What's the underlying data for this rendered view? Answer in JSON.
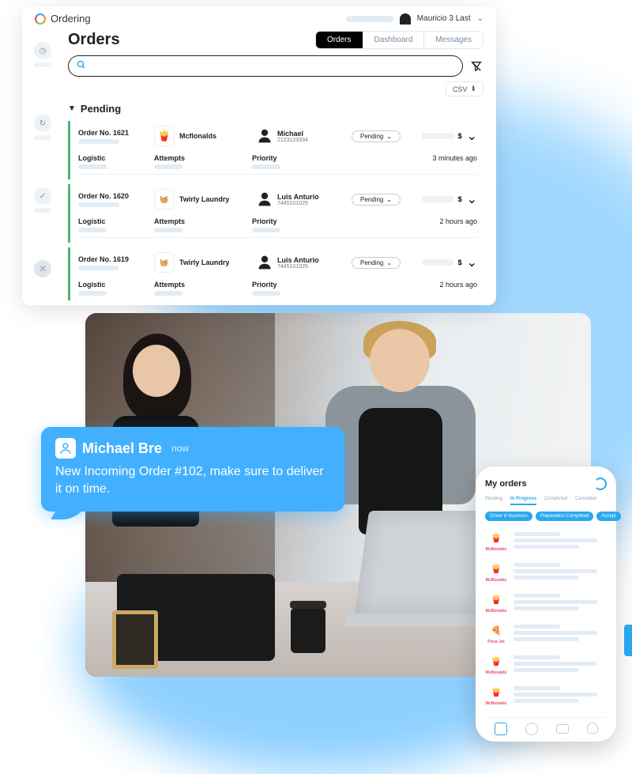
{
  "brand": "Ordering",
  "user": {
    "name": "Mauricio 3 Last"
  },
  "header": {
    "title": "Orders"
  },
  "tabs": [
    "Orders",
    "Dashboard",
    "Messages"
  ],
  "activeTab": 0,
  "csv_label": "CSV",
  "section": "Pending",
  "meta_labels": {
    "logistic": "Logistic",
    "attempts": "Attempts",
    "priority": "Priority"
  },
  "currency": "$",
  "orders": [
    {
      "num": "Order No. 1621",
      "business": "Mcflonalds",
      "business_kind": "fries",
      "customer": {
        "name": "Michael",
        "phone": "2123123334"
      },
      "status": "Pending",
      "time": "3 minutes ago"
    },
    {
      "num": "Order No. 1620",
      "business": "Twirly Laundry",
      "business_kind": "laundry",
      "customer": {
        "name": "Luis Anturio",
        "phone": "7445101025"
      },
      "status": "Pending",
      "time": "2 hours ago"
    },
    {
      "num": "Order No. 1619",
      "business": "Twirly Laundry",
      "business_kind": "laundry",
      "customer": {
        "name": "Luis Anturio",
        "phone": "7445101025"
      },
      "status": "Pending",
      "time": "2 hours ago"
    }
  ],
  "chat": {
    "name": "Michael Bre",
    "time": "now",
    "message": "New Incoming Order #102, make sure to deliver it on time."
  },
  "phone": {
    "title": "My orders",
    "tabs": [
      "Pending",
      "In Progress",
      "Completed",
      "Cancelled"
    ],
    "activeTab": 1,
    "filters": [
      "Driver in business",
      "Preparation Completed",
      "Accept"
    ],
    "items": [
      {
        "kind": "fries",
        "caption": "McBonalds"
      },
      {
        "kind": "fries",
        "caption": "McBonalds"
      },
      {
        "kind": "fries",
        "caption": "McBonalds"
      },
      {
        "kind": "pizza",
        "caption": "Pizza Jot"
      },
      {
        "kind": "fries",
        "caption": "McBonalds"
      },
      {
        "kind": "fries",
        "caption": "McBonalds"
      }
    ]
  }
}
